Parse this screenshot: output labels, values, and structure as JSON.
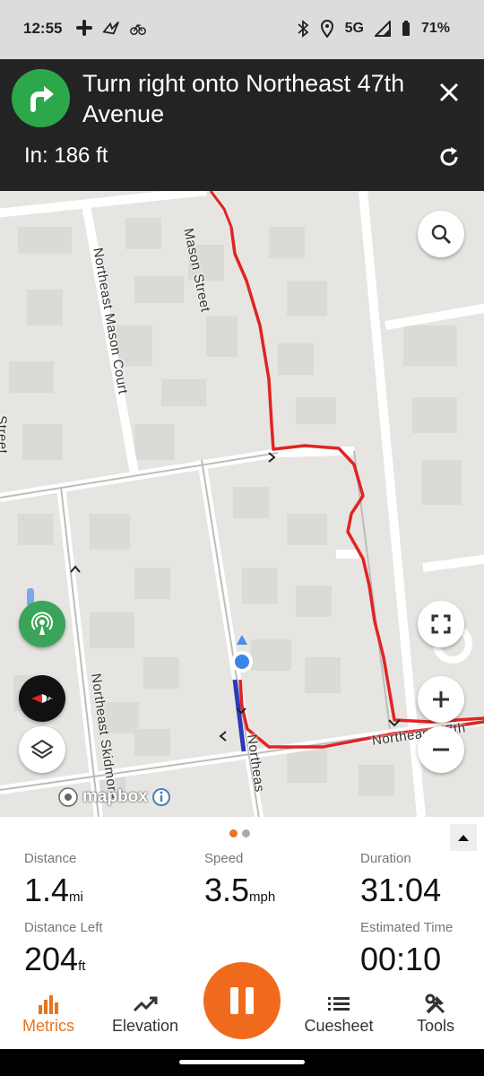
{
  "status_bar": {
    "time": "12:55",
    "network": "5G",
    "battery": "71%"
  },
  "navigation": {
    "instruction": "Turn right onto Northeast 47th Avenue",
    "distance": "In: 186 ft",
    "turn_icon": "turn-right-arrow",
    "accent_color": "#2ca84a"
  },
  "map": {
    "streets": {
      "mason_street": "Mason Street",
      "mason_court": "Northeast Mason Court",
      "skidmore": "Northeast Skidmore",
      "northeast_47th": "Northeast 47th",
      "northeast_partial": "Northeas",
      "edge_partial": "Street"
    },
    "attribution": "mapbox",
    "route_color": "#e02424"
  },
  "metrics": {
    "distance": {
      "label": "Distance",
      "value": "1.4",
      "unit": "mi"
    },
    "speed": {
      "label": "Speed",
      "value": "3.5",
      "unit": "mph"
    },
    "duration": {
      "label": "Duration",
      "value": "31:04"
    },
    "distance_left": {
      "label": "Distance Left",
      "value": "204",
      "unit": "ft"
    },
    "estimated_time": {
      "label": "Estimated Time",
      "value": "00:10"
    }
  },
  "bottom_nav": {
    "metrics": "Metrics",
    "elevation": "Elevation",
    "cuesheet": "Cuesheet",
    "tools": "Tools",
    "active_color": "#e8731f",
    "pause_color": "#f06a1e"
  }
}
